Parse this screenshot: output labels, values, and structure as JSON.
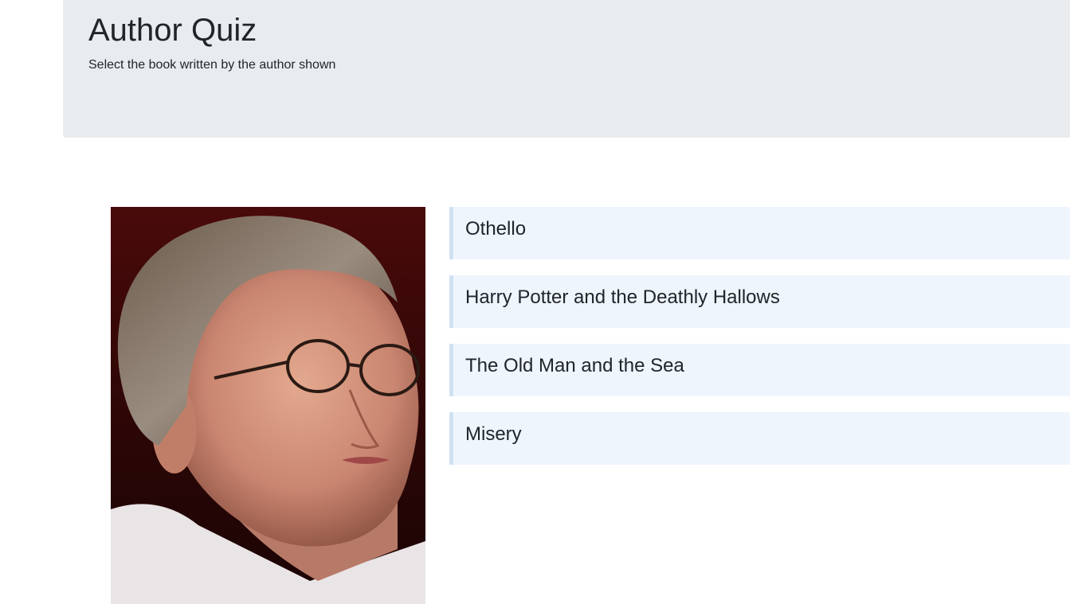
{
  "header": {
    "title": "Author Quiz",
    "subtitle": "Select the book written by the author shown"
  },
  "author": {
    "image_icon": "author-portrait"
  },
  "answers": [
    {
      "title": "Othello"
    },
    {
      "title": "Harry Potter and the Deathly Hallows"
    },
    {
      "title": "The Old Man and the Sea"
    },
    {
      "title": "Misery"
    }
  ],
  "colors": {
    "jumbotron_bg": "#e9ecef",
    "answer_bg": "#eef5fd",
    "answer_border": "#cfe2f3",
    "text": "#212529"
  }
}
